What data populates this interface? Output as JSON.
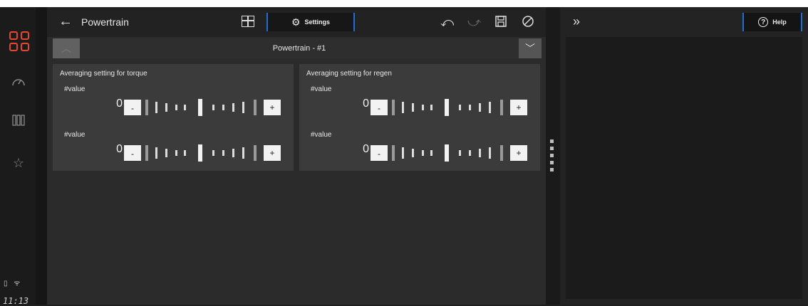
{
  "header": {
    "back_icon": "arrow-left-icon",
    "title": "Powertrain",
    "settings_label": "Settings",
    "icons": [
      "grid-icon",
      "gear-icon",
      "undo-icon",
      "redo-icon",
      "save-icon",
      "cancel-icon"
    ]
  },
  "subbar": {
    "title": "Powertrain - #1"
  },
  "cards": [
    {
      "title": "Averaging setting for torque",
      "rows": [
        {
          "label": "#value",
          "value": "0",
          "minus": "-",
          "plus": "+"
        },
        {
          "label": "#value",
          "value": "0",
          "minus": "-",
          "plus": "+"
        }
      ]
    },
    {
      "title": "Averaging setting for regen",
      "rows": [
        {
          "label": "#value",
          "value": "0",
          "minus": "-",
          "plus": "+"
        },
        {
          "label": "#value",
          "value": "0",
          "minus": "-",
          "plus": "+"
        }
      ]
    }
  ],
  "sidebar": {
    "icons": [
      "apps-icon",
      "gauge-icon",
      "columns-icon",
      "star-icon"
    ],
    "status_icons": [
      "battery-icon",
      "wifi-icon"
    ],
    "time": "11:13"
  },
  "right_panel": {
    "expand_icon": "double-chevron-right-icon",
    "help_label": "Help"
  },
  "colors": {
    "accent": "#1e6fd9",
    "brand": "#e8462a",
    "background": "#2b2b2b"
  }
}
